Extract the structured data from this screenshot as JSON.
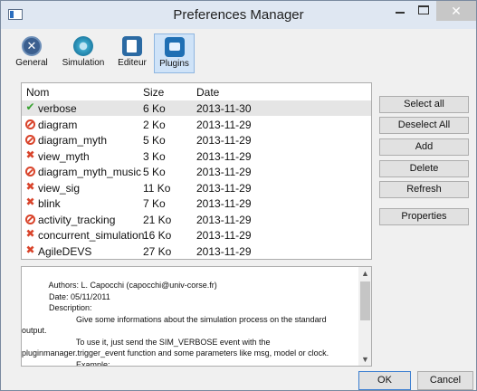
{
  "window": {
    "title": "Preferences Manager",
    "min_glyph": "—",
    "max_glyph": "□",
    "close_glyph": "✕"
  },
  "toolbar": {
    "items": [
      {
        "label": "General",
        "icon": "tools-icon"
      },
      {
        "label": "Simulation",
        "icon": "simulation-icon"
      },
      {
        "label": "Editeur",
        "icon": "editor-icon"
      },
      {
        "label": "Plugins",
        "icon": "plugins-icon",
        "selected": true
      }
    ]
  },
  "list": {
    "columns": [
      "Nom",
      "Size",
      "Date"
    ],
    "rows": [
      {
        "name": "verbose",
        "size": "6 Ko",
        "date": "2013-11-30",
        "status": "enabled",
        "selected": true
      },
      {
        "name": "diagram",
        "size": "2 Ko",
        "date": "2013-11-29",
        "status": "disabled"
      },
      {
        "name": "diagram_myth",
        "size": "5 Ko",
        "date": "2013-11-29",
        "status": "disabled"
      },
      {
        "name": "view_myth",
        "size": "3 Ko",
        "date": "2013-11-29",
        "status": "error"
      },
      {
        "name": "diagram_myth_music",
        "size": "5 Ko",
        "date": "2013-11-29",
        "status": "disabled"
      },
      {
        "name": "view_sig",
        "size": "11 Ko",
        "date": "2013-11-29",
        "status": "error"
      },
      {
        "name": "blink",
        "size": "7 Ko",
        "date": "2013-11-29",
        "status": "error"
      },
      {
        "name": "activity_tracking",
        "size": "21 Ko",
        "date": "2013-11-29",
        "status": "disabled"
      },
      {
        "name": "concurrent_simulation",
        "size": "16 Ko",
        "date": "2013-11-29",
        "status": "error"
      },
      {
        "name": "AgileDEVS",
        "size": "27 Ko",
        "date": "2013-11-29",
        "status": "error"
      }
    ]
  },
  "side_buttons": [
    "Select all",
    "Deselect All",
    "Add",
    "Delete",
    "Refresh",
    "Properties"
  ],
  "description": {
    "text": "            Authors: L. Capocchi (capocchi@univ-corse.fr)\n            Date: 05/11/2011\n            Description:\n                        Give some informations about the simulation process on the standard\noutput.\n                        To use it, just send the SIM_VERBOSE event with the\npluginmanager.trigger_event function and some parameters like msg, model or clock.\n                        Example:"
  },
  "dialog": {
    "ok_label": "OK",
    "cancel_label": "Cancel"
  },
  "colors": {
    "selected_tab": "#cfe3f8",
    "enabled": "#35a12e",
    "error": "#d9442b"
  }
}
